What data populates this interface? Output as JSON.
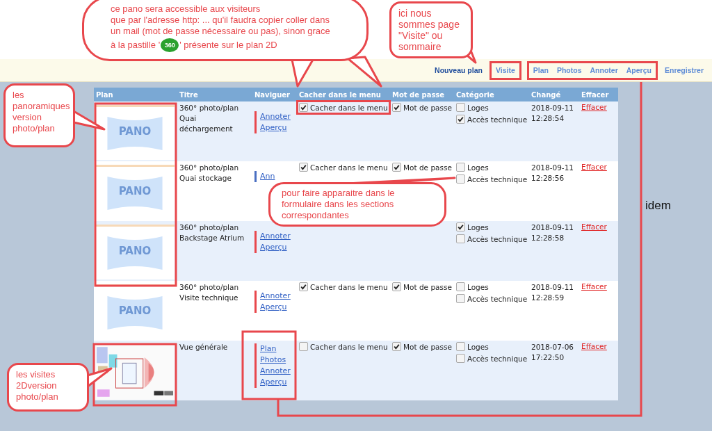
{
  "nav": [
    {
      "label": "Nouveau plan",
      "kind": "new"
    },
    {
      "label": "Visite",
      "kind": "link"
    },
    {
      "label": "Plan",
      "kind": "link"
    },
    {
      "label": "Photos",
      "kind": "link"
    },
    {
      "label": "Annoter",
      "kind": "link"
    },
    {
      "label": "Aperçu",
      "kind": "link"
    },
    {
      "label": "Enregistrer",
      "kind": "link"
    }
  ],
  "table": {
    "columns": [
      "Plan",
      "Titre",
      "Naviguer",
      "Cacher dans le menu",
      "Mot de passe",
      "Catégorie",
      "Changé",
      "Effacer"
    ],
    "rows": [
      {
        "thumb": {
          "kind": "pano",
          "label": "PANO"
        },
        "title": [
          "360° photo/plan",
          "Quai",
          "déchargement"
        ],
        "color": "#e8474c",
        "links": [
          "Annoter",
          "Aperçu"
        ],
        "hide": {
          "label": "Cacher dans le menu",
          "checked": true
        },
        "password": {
          "label": "Mot de passe",
          "checked": true
        },
        "categories": [
          {
            "label": "Loges",
            "checked": false
          },
          {
            "label": "Accès technique",
            "checked": true
          }
        ],
        "changed": [
          "2018-09-11",
          "12:28:54"
        ],
        "delete": "Effacer"
      },
      {
        "thumb": {
          "kind": "pano",
          "label": "PANO"
        },
        "title": [
          "360° photo/plan",
          "Quai stockage"
        ],
        "color": "#4a6fc2",
        "links": [
          "Ann"
        ],
        "hide": {
          "label": "Cacher dans le menu",
          "checked": true
        },
        "password": {
          "label": "Mot de passe",
          "checked": true
        },
        "categories": [
          {
            "label": "Loges",
            "checked": false
          },
          {
            "label": "Accès technique",
            "checked": false
          }
        ],
        "changed": [
          "2018-09-11",
          "12:28:56"
        ],
        "delete": "Effacer"
      },
      {
        "thumb": {
          "kind": "pano",
          "label": "PANO"
        },
        "title": [
          "360° photo/plan",
          "Backstage Atrium"
        ],
        "color": "#e8474c",
        "links": [
          "Annoter",
          "Aperçu"
        ],
        "categories": [
          {
            "label": "Loges",
            "checked": true
          },
          {
            "label": "Accès technique",
            "checked": false
          }
        ],
        "changed": [
          "2018-09-11",
          "12:28:58"
        ],
        "delete": "Effacer"
      },
      {
        "thumb": {
          "kind": "pano",
          "label": "PANO"
        },
        "title": [
          "360° photo/plan",
          "Visite technique"
        ],
        "color": "#e8474c",
        "links": [
          "Annoter",
          "Aperçu"
        ],
        "hide": {
          "label": "Cacher dans le menu",
          "checked": true
        },
        "password": {
          "label": "Mot de passe",
          "checked": true
        },
        "categories": [
          {
            "label": "Loges",
            "checked": false
          },
          {
            "label": "Accès technique",
            "checked": false
          }
        ],
        "changed": [
          "2018-09-11",
          "12:28:59"
        ],
        "delete": "Effacer"
      },
      {
        "thumb": {
          "kind": "picture"
        },
        "title": [
          "Vue générale"
        ],
        "color": "#e8474c",
        "links": [
          "Plan",
          "Photos",
          "Annoter",
          "Aperçu"
        ],
        "hide": {
          "label": "Cacher dans le menu",
          "checked": false
        },
        "password": {
          "label": "Mot de passe",
          "checked": true
        },
        "categories": [
          {
            "label": "Loges",
            "checked": false
          },
          {
            "label": "Accès technique",
            "checked": false
          }
        ],
        "changed": [
          "2018-07-06",
          "17:22:50"
        ],
        "delete": "Effacer"
      }
    ]
  },
  "notes": {
    "top": {
      "lines": [
        "ce pano sera accessible  aux visiteurs",
        "que par l'adresse http: ... qu'il faudra copier coller dans",
        "un mail (mot de passe nécessaire ou pas), sinon grace"
      ],
      "before": "à la pastille '",
      "badge": "360",
      "after": "' présente sur le plan 2D"
    },
    "page": "ici nous sommes page \"Visite\" ou sommaire",
    "panos": "les panoramiques version photo/plan",
    "visits": "les visites 2Dversion photo/plan",
    "form": "pour faire apparaitre dans le formulaire dans les sections correspondantes",
    "idem": "idem"
  }
}
